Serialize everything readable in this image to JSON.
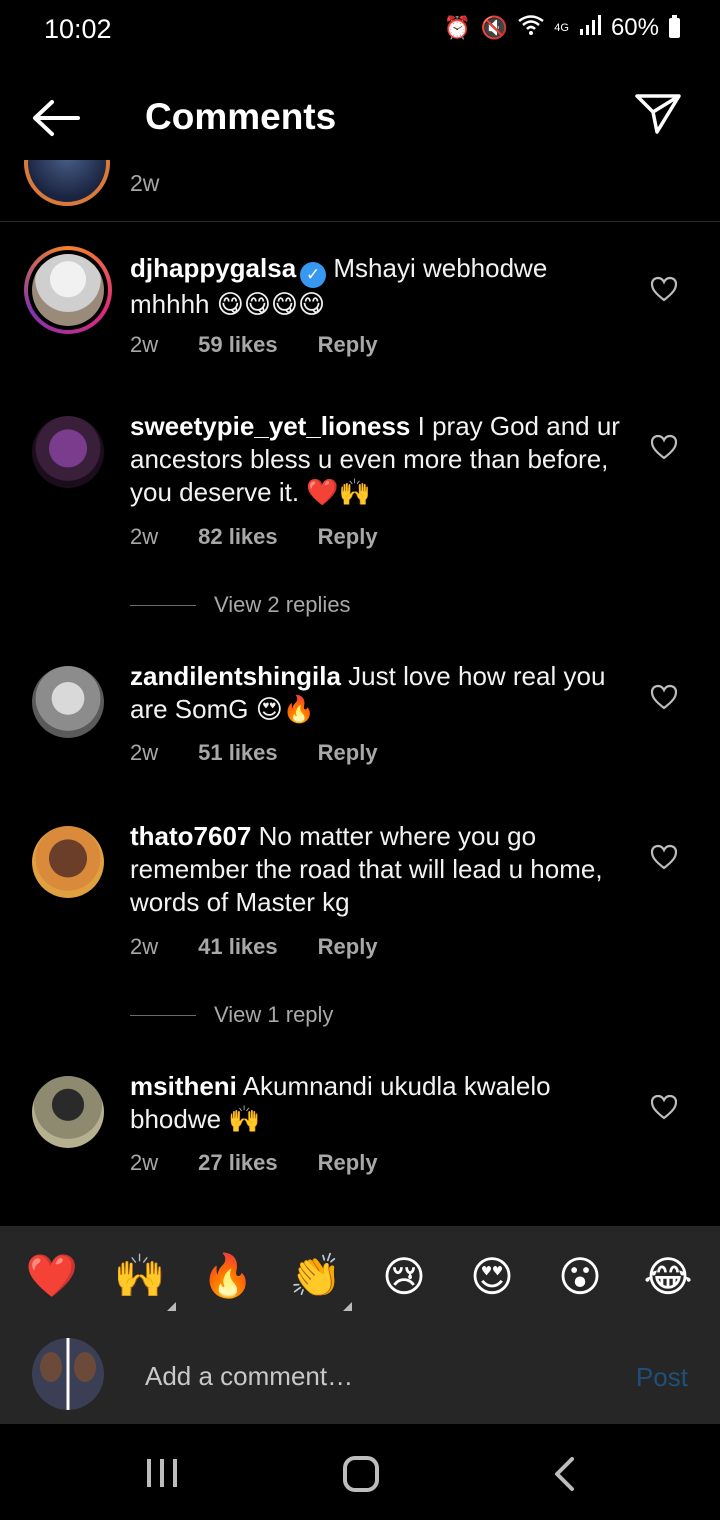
{
  "status_bar": {
    "time": "10:02",
    "network": "4G",
    "battery": "60%",
    "icons": [
      "alarm-icon",
      "mute-icon",
      "wifi-icon",
      "signal-icon",
      "battery-icon"
    ]
  },
  "header": {
    "title": "Comments",
    "back_icon": "back-arrow-icon",
    "share_icon": "send-icon"
  },
  "partial_comment": {
    "time": "2w"
  },
  "comments": [
    {
      "username": "djhappygalsa",
      "verified": true,
      "text": "Mshayi webhodwe mhhhh 😋😋😋😋",
      "time": "2w",
      "likes": "59 likes",
      "reply": "Reply"
    },
    {
      "username": "sweetypie_yet_lioness",
      "text": "I pray God and ur ancestors bless u even more than before, you deserve it. ❤️🙌",
      "time": "2w",
      "likes": "82 likes",
      "reply": "Reply",
      "view_replies": "View 2 replies"
    },
    {
      "username": "zandilentshingila",
      "text": "Just love how real you are SomG 😍🔥",
      "time": "2w",
      "likes": "51 likes",
      "reply": "Reply"
    },
    {
      "username": "thato7607",
      "text": "No matter where you go remember the road that will lead u home, words of Master kg",
      "time": "2w",
      "likes": "41 likes",
      "reply": "Reply",
      "view_replies": "View 1 reply"
    },
    {
      "username": "msitheni",
      "text": "Akumnandi ukudla kwalelo bhodwe 🙌",
      "time": "2w",
      "likes": "27 likes",
      "reply": "Reply"
    }
  ],
  "emoji_bar": [
    "❤️",
    "🙌",
    "🔥",
    "👏",
    "😢",
    "😍",
    "😮",
    "😂"
  ],
  "composer": {
    "placeholder": "Add a comment…",
    "post_label": "Post"
  },
  "colors": {
    "background": "#000000",
    "panel": "#262626",
    "secondary_text": "#a8a8a8",
    "verified": "#3897f0",
    "post_disabled": "#1f4f7a"
  }
}
